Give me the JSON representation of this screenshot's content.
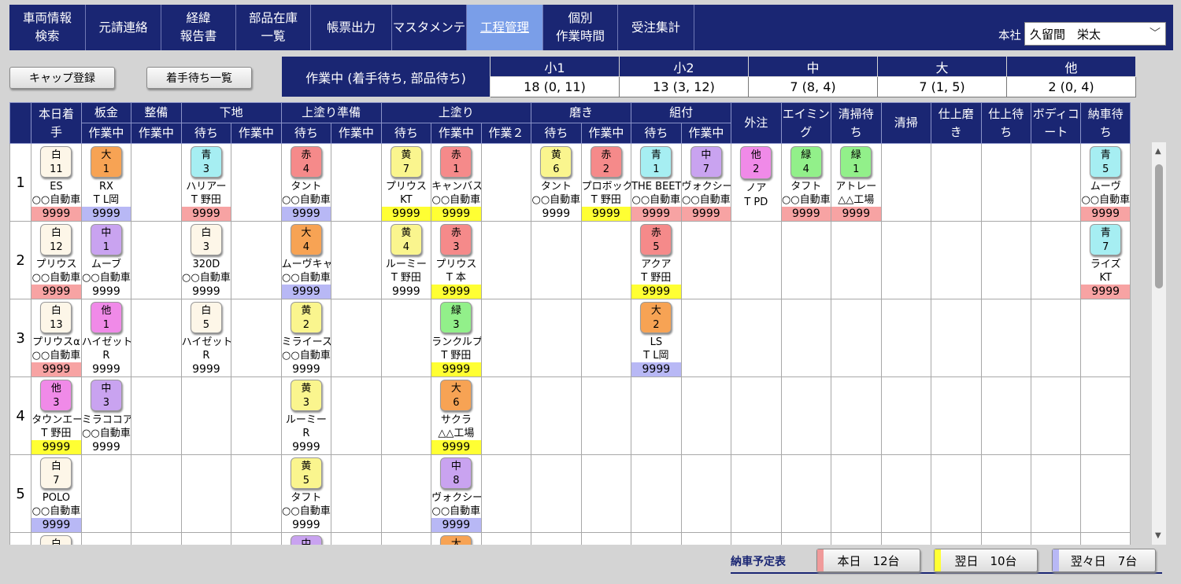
{
  "nav": {
    "items": [
      {
        "label": "車両情報\n検索",
        "width": 97
      },
      {
        "label": "元請連絡",
        "width": 96
      },
      {
        "label": "経緯\n報告書",
        "width": 95
      },
      {
        "label": "部品在庫\n一覧",
        "width": 95
      },
      {
        "label": "帳票出力",
        "width": 103
      },
      {
        "label": "マスタメンテ",
        "width": 95
      },
      {
        "label": "工程管理",
        "width": 97,
        "active": true
      },
      {
        "label": "個別\n作業時間",
        "width": 95
      },
      {
        "label": "受注集計",
        "width": 97
      }
    ],
    "office_label": "本社",
    "user": "久留間　栄太"
  },
  "buttons": {
    "cap_register": "キャップ登録",
    "waiting_list": "着手待ち一覧"
  },
  "summary": {
    "title": "作業中 (着手待ち, 部品待ち)",
    "headers": [
      "小1",
      "小2",
      "中",
      "大",
      "他"
    ],
    "values": [
      "18 (0, 11)",
      "13 (3, 12)",
      "7 (8, 4)",
      "7 (1, 5)",
      "2 (0, 4)"
    ]
  },
  "grid": {
    "headers_top": [
      {
        "label": "本日着\n手",
        "span": 1,
        "rows": 2
      },
      {
        "label": "板金",
        "span": 1
      },
      {
        "label": "整備",
        "span": 1
      },
      {
        "label": "下地",
        "span": 2
      },
      {
        "label": "上塗り準備",
        "span": 2
      },
      {
        "label": "上塗り",
        "span": 3
      },
      {
        "label": "磨き",
        "span": 2
      },
      {
        "label": "組付",
        "span": 2
      },
      {
        "label": "外注",
        "span": 1,
        "rows": 2
      },
      {
        "label": "エイミン\nグ",
        "span": 1,
        "rows": 2
      },
      {
        "label": "清掃待\nち",
        "span": 1,
        "rows": 2
      },
      {
        "label": "清掃",
        "span": 1,
        "rows": 2
      },
      {
        "label": "仕上磨\nき",
        "span": 1,
        "rows": 2
      },
      {
        "label": "仕上待\nち",
        "span": 1,
        "rows": 2
      },
      {
        "label": "ボディコ\nート",
        "span": 1,
        "rows": 2
      },
      {
        "label": "納車待\nち",
        "span": 1,
        "rows": 2
      }
    ],
    "headers_sub": [
      "作業中",
      "作業中",
      "待ち",
      "作業中",
      "待ち",
      "作業中",
      "待ち",
      "作業中",
      "作業２",
      "待ち",
      "作業中",
      "待ち",
      "作業中"
    ],
    "rows": [
      {
        "no": "1",
        "cells": [
          {
            "c": "白",
            "n": "11",
            "name": "ES",
            "sub": "○○自動車",
            "num": "9999",
            "hl": "r"
          },
          {
            "c": "大",
            "n": "1",
            "name": "RX",
            "sub": "T  L岡",
            "num": "9999",
            "hl": "p"
          },
          null,
          {
            "c": "青",
            "n": "3",
            "name": "ハリアー",
            "sub": "T  野田",
            "num": "9999",
            "hl": "r"
          },
          null,
          {
            "c": "赤",
            "n": "4",
            "name": "タント",
            "sub": "○○自動車",
            "num": "9999",
            "hl": "p"
          },
          null,
          {
            "c": "黄",
            "n": "7",
            "name": "プリウス",
            "sub": "KT",
            "num": "9999",
            "hl": "y"
          },
          {
            "c": "赤",
            "n": "1",
            "name": "キャンバス",
            "sub": "○○自動車",
            "num": "9999",
            "hl": "y"
          },
          null,
          {
            "c": "黄",
            "n": "6",
            "name": "タント",
            "sub": "○○自動車",
            "num": "9999",
            "hl": ""
          },
          {
            "c": "赤",
            "n": "2",
            "name": "プロボックス",
            "sub": "T  野田",
            "num": "9999",
            "hl": "y"
          },
          {
            "c": "青",
            "n": "1",
            "name": "THE BEETLE",
            "sub": "○○自動車",
            "num": "9999",
            "hl": "r"
          },
          {
            "c": "中",
            "n": "7",
            "name": "ヴォクシー",
            "sub": "○○自動車",
            "num": "9999",
            "hl": "r"
          },
          {
            "c": "他",
            "n": "2",
            "name": "ノア",
            "sub": "T  PD",
            "num": "",
            "hl": "y"
          },
          {
            "c": "緑",
            "n": "4",
            "name": "タフト",
            "sub": "○○自動車",
            "num": "9999",
            "hl": "r"
          },
          {
            "c": "緑",
            "n": "1",
            "name": "アトレー",
            "sub": "△△工場",
            "num": "9999",
            "hl": "r"
          },
          null,
          null,
          null,
          null,
          {
            "c": "青",
            "n": "5",
            "name": "ムーヴ",
            "sub": "○○自動車",
            "num": "9999",
            "hl": "r"
          }
        ]
      },
      {
        "no": "2",
        "cells": [
          {
            "c": "白",
            "n": "12",
            "name": "プリウス",
            "sub": "○○自動車",
            "num": "9999",
            "hl": "r"
          },
          {
            "c": "中",
            "n": "1",
            "name": "ムーブ",
            "sub": "○○自動車",
            "num": "9999",
            "hl": ""
          },
          null,
          {
            "c": "白",
            "n": "3",
            "name": "320D",
            "sub": "○○自動車",
            "num": "9999",
            "hl": ""
          },
          null,
          {
            "c": "大",
            "n": "4",
            "name": "ムーヴキャンバス",
            "sub": "○○自動車",
            "num": "9999",
            "hl": "p"
          },
          null,
          {
            "c": "黄",
            "n": "4",
            "name": "ルーミー",
            "sub": "T  野田",
            "num": "9999",
            "hl": ""
          },
          {
            "c": "赤",
            "n": "3",
            "name": "プリウス",
            "sub": "T  本",
            "num": "9999",
            "hl": "y"
          },
          null,
          null,
          null,
          {
            "c": "赤",
            "n": "5",
            "name": "アクア",
            "sub": "T  野田",
            "num": "9999",
            "hl": "y"
          },
          null,
          null,
          null,
          null,
          null,
          null,
          null,
          null,
          {
            "c": "青",
            "n": "7",
            "name": "ライズ",
            "sub": "KT",
            "num": "9999",
            "hl": "r"
          }
        ]
      },
      {
        "no": "3",
        "cells": [
          {
            "c": "白",
            "n": "13",
            "name": "プリウスα",
            "sub": "○○自動車",
            "num": "9999",
            "hl": "r"
          },
          {
            "c": "他",
            "n": "1",
            "name": "ハイゼット",
            "sub": "R",
            "num": "9999",
            "hl": ""
          },
          null,
          {
            "c": "白",
            "n": "5",
            "name": "ハイゼットカーゴ",
            "sub": "R",
            "num": "9999",
            "hl": ""
          },
          null,
          {
            "c": "黄",
            "n": "2",
            "name": "ミライース",
            "sub": "○○自動車",
            "num": "9999",
            "hl": ""
          },
          null,
          null,
          {
            "c": "緑",
            "n": "3",
            "name": "ランクルプラド",
            "sub": "T  野田",
            "num": "9999",
            "hl": "y"
          },
          null,
          null,
          null,
          {
            "c": "大",
            "n": "2",
            "name": "LS",
            "sub": "T  L岡",
            "num": "9999",
            "hl": "p"
          },
          null,
          null,
          null,
          null,
          null,
          null,
          null,
          null,
          null
        ]
      },
      {
        "no": "4",
        "cells": [
          {
            "c": "他",
            "n": "3",
            "name": "タウンエース",
            "sub": "T  野田",
            "num": "9999",
            "hl": "y"
          },
          {
            "c": "中",
            "n": "3",
            "name": "ミラココア",
            "sub": "○○自動車",
            "num": "9999",
            "hl": ""
          },
          null,
          null,
          null,
          {
            "c": "黄",
            "n": "3",
            "name": "ルーミー",
            "sub": "R",
            "num": "9999",
            "hl": ""
          },
          null,
          null,
          {
            "c": "大",
            "n": "6",
            "name": "サクラ",
            "sub": "△△工場",
            "num": "9999",
            "hl": "y"
          },
          null,
          null,
          null,
          null,
          null,
          null,
          null,
          null,
          null,
          null,
          null,
          null,
          null
        ]
      },
      {
        "no": "5",
        "cells": [
          {
            "c": "白",
            "n": "7",
            "name": "POLO",
            "sub": "○○自動車",
            "num": "9999",
            "hl": "p"
          },
          null,
          null,
          null,
          null,
          {
            "c": "黄",
            "n": "5",
            "name": "タフト",
            "sub": "○○自動車",
            "num": "9999",
            "hl": ""
          },
          null,
          null,
          {
            "c": "中",
            "n": "8",
            "name": "ヴォクシー",
            "sub": "○○自動車",
            "num": "9999",
            "hl": "p"
          },
          null,
          null,
          null,
          null,
          null,
          null,
          null,
          null,
          null,
          null,
          null,
          null,
          null
        ]
      },
      {
        "no": "",
        "cells": [
          {
            "c": "白",
            "n": "",
            "name": "",
            "sub": "",
            "num": "",
            "hl": ""
          },
          null,
          null,
          null,
          null,
          {
            "c": "中",
            "n": "",
            "name": "",
            "sub": "",
            "num": "",
            "hl": ""
          },
          null,
          null,
          {
            "c": "大",
            "n": "",
            "name": "",
            "sub": "",
            "num": "",
            "hl": ""
          },
          null,
          null,
          null,
          null,
          null,
          null,
          null,
          null,
          null,
          null,
          null,
          null,
          null
        ]
      }
    ]
  },
  "tile_colors": {
    "白": "#fdf6e8",
    "大": "#f7a354",
    "青": "#a6eef2",
    "赤": "#f58a8a",
    "黄": "#faf58e",
    "中": "#c9a3f0",
    "他": "#f08ae8",
    "緑": "#92f08a"
  },
  "highlight_colors": {
    "r": "#f7a3a3",
    "p": "#b8b8f5",
    "y": "#ffff33"
  },
  "footer": {
    "title": "納車予定表",
    "buttons": [
      {
        "label": "本日　12台",
        "color": "#f09a9a"
      },
      {
        "label": "翌日　10台",
        "color": "#ffff33"
      },
      {
        "label": "翌々日　7台",
        "color": "#b8b8f5"
      }
    ]
  }
}
